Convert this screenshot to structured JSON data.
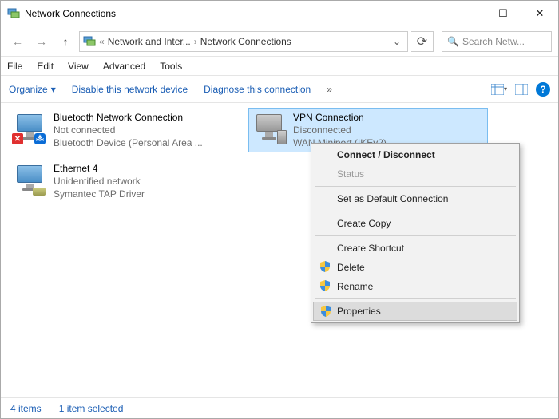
{
  "window": {
    "title": "Network Connections"
  },
  "nav": {
    "crumb1": "Network and Inter...",
    "crumb2": "Network Connections",
    "search_placeholder": "Search Netw..."
  },
  "menu": {
    "file": "File",
    "edit": "Edit",
    "view": "View",
    "advanced": "Advanced",
    "tools": "Tools"
  },
  "toolbar": {
    "organize": "Organize",
    "disable": "Disable this network device",
    "diagnose": "Diagnose this connection"
  },
  "items": [
    {
      "name": "Bluetooth Network Connection",
      "status": "Not connected",
      "device": "Bluetooth Device (Personal Area ..."
    },
    {
      "name": "VPN Connection",
      "status": "Disconnected",
      "device": "WAN Miniport (IKEv2)"
    },
    {
      "name": "Ethernet 4",
      "status": "Unidentified network",
      "device": "Symantec TAP Driver"
    }
  ],
  "context": {
    "connect": "Connect / Disconnect",
    "status": "Status",
    "default": "Set as Default Connection",
    "copy": "Create Copy",
    "shortcut": "Create Shortcut",
    "delete": "Delete",
    "rename": "Rename",
    "properties": "Properties"
  },
  "status": {
    "count": "4 items",
    "selected": "1 item selected"
  }
}
